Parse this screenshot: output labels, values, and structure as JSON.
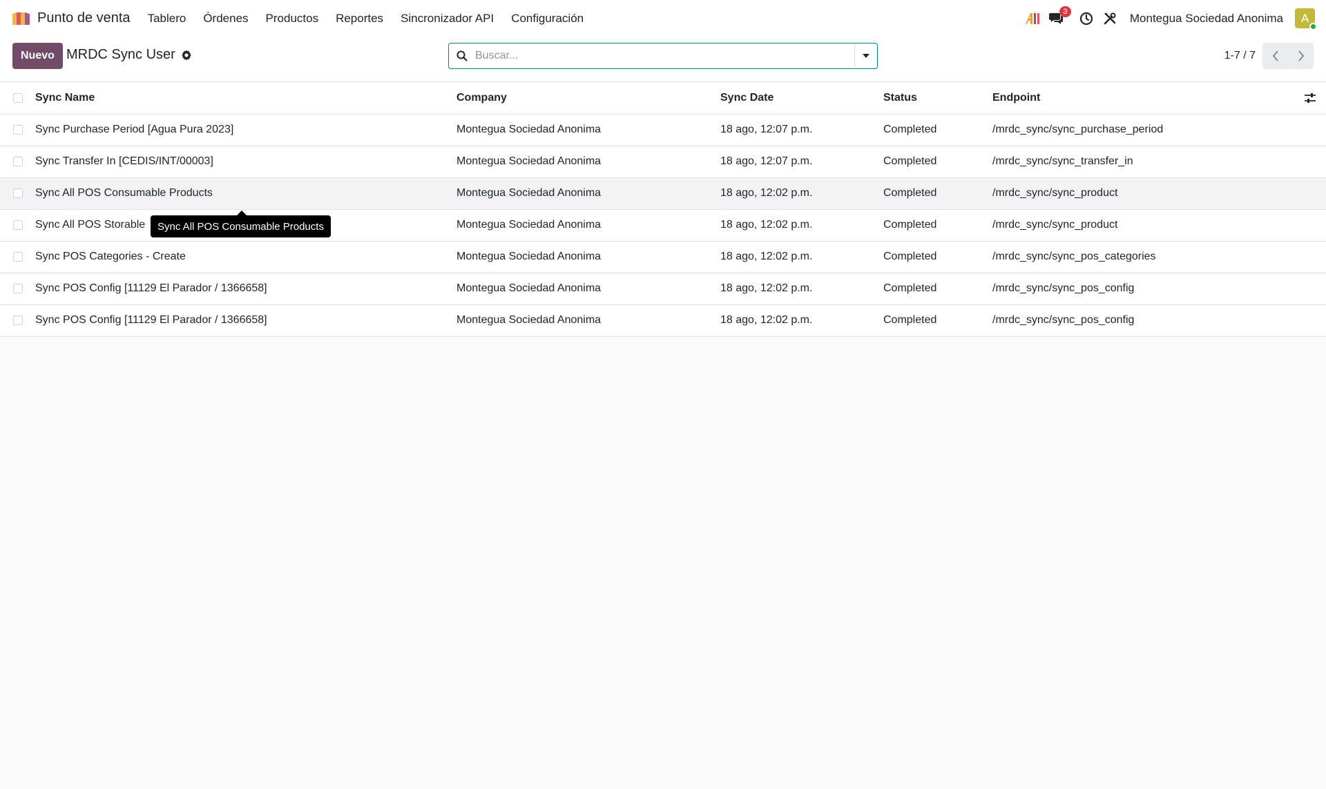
{
  "navbar": {
    "app_name": "Punto de venta",
    "menu": [
      "Tablero",
      "Órdenes",
      "Productos",
      "Reportes",
      "Sincronizador API",
      "Configuración"
    ],
    "notification_count": "3",
    "company": "Montegua Sociedad Anonima",
    "avatar_letter": "A",
    "icons": [
      "ai-icon",
      "chat-icon",
      "clock-icon",
      "tools-icon"
    ]
  },
  "control_panel": {
    "new_label": "Nuevo",
    "title": "MRDC Sync User",
    "search_placeholder": "Buscar...",
    "pager": "1-7 / 7"
  },
  "table": {
    "headers": {
      "name": "Sync Name",
      "company": "Company",
      "date": "Sync Date",
      "status": "Status",
      "endpoint": "Endpoint"
    },
    "rows": [
      {
        "name": "Sync Purchase Period [Agua Pura 2023]",
        "company": "Montegua Sociedad Anonima",
        "date": "18 ago, 12:07 p.m.",
        "status": "Completed",
        "endpoint": "/mrdc_sync/sync_purchase_period"
      },
      {
        "name": "Sync Transfer In [CEDIS/INT/00003]",
        "company": "Montegua Sociedad Anonima",
        "date": "18 ago, 12:07 p.m.",
        "status": "Completed",
        "endpoint": "/mrdc_sync/sync_transfer_in"
      },
      {
        "name": "Sync All POS Consumable Products",
        "company": "Montegua Sociedad Anonima",
        "date": "18 ago, 12:02 p.m.",
        "status": "Completed",
        "endpoint": "/mrdc_sync/sync_product"
      },
      {
        "name": "Sync All POS Storable",
        "company": "Montegua Sociedad Anonima",
        "date": "18 ago, 12:02 p.m.",
        "status": "Completed",
        "endpoint": "/mrdc_sync/sync_product"
      },
      {
        "name": "Sync POS Categories - Create",
        "company": "Montegua Sociedad Anonima",
        "date": "18 ago, 12:02 p.m.",
        "status": "Completed",
        "endpoint": "/mrdc_sync/sync_pos_categories"
      },
      {
        "name": "Sync POS Config [11129 El Parador / 1366658]",
        "company": "Montegua Sociedad Anonima",
        "date": "18 ago, 12:02 p.m.",
        "status": "Completed",
        "endpoint": "/mrdc_sync/sync_pos_config"
      },
      {
        "name": "Sync POS Config [11129 El Parador / 1366658]",
        "company": "Montegua Sociedad Anonima",
        "date": "18 ago, 12:02 p.m.",
        "status": "Completed",
        "endpoint": "/mrdc_sync/sync_pos_config"
      }
    ]
  },
  "tooltip": {
    "text": "Sync All POS Consumable Products"
  },
  "colors": {
    "primary": "#714b67",
    "search_border": "#017e84",
    "badge": "#d9383e",
    "avatar": "#c3b93a"
  }
}
